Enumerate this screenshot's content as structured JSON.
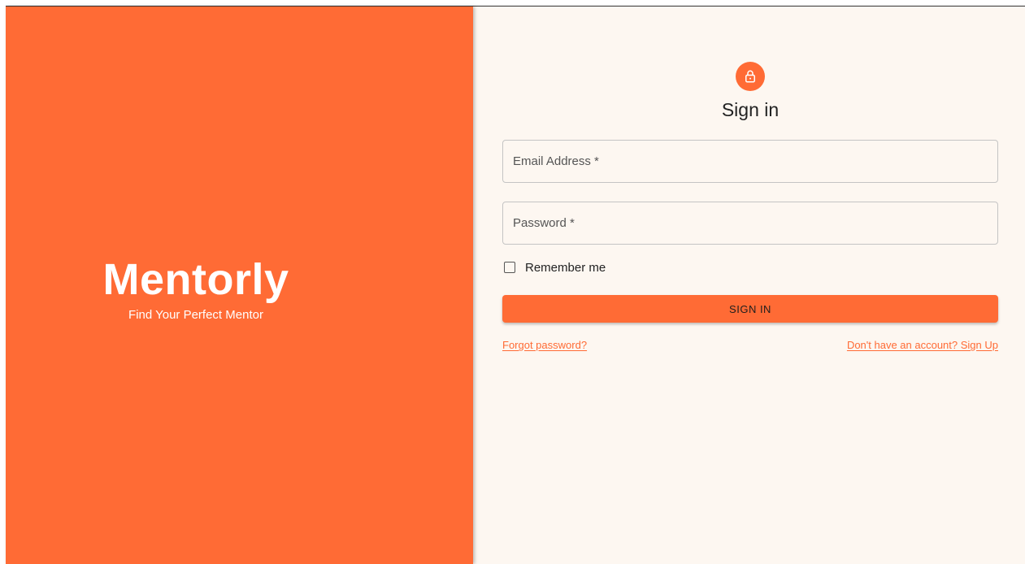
{
  "brand": {
    "name": "Mentorly",
    "tagline": "Find Your Perfect Mentor"
  },
  "signin": {
    "icon": "lock-icon",
    "title": "Sign in",
    "email_label": "Email Address *",
    "password_label": "Password *",
    "email_value": "",
    "password_value": "",
    "remember_label": "Remember me",
    "remember_checked": false,
    "submit_label": "SIGN IN",
    "forgot_link": "Forgot password?",
    "signup_link": "Don't have an account? Sign Up"
  },
  "colors": {
    "accent": "#ff6b35",
    "form_background": "#fdf7f1",
    "brand_text": "#ffffff"
  }
}
